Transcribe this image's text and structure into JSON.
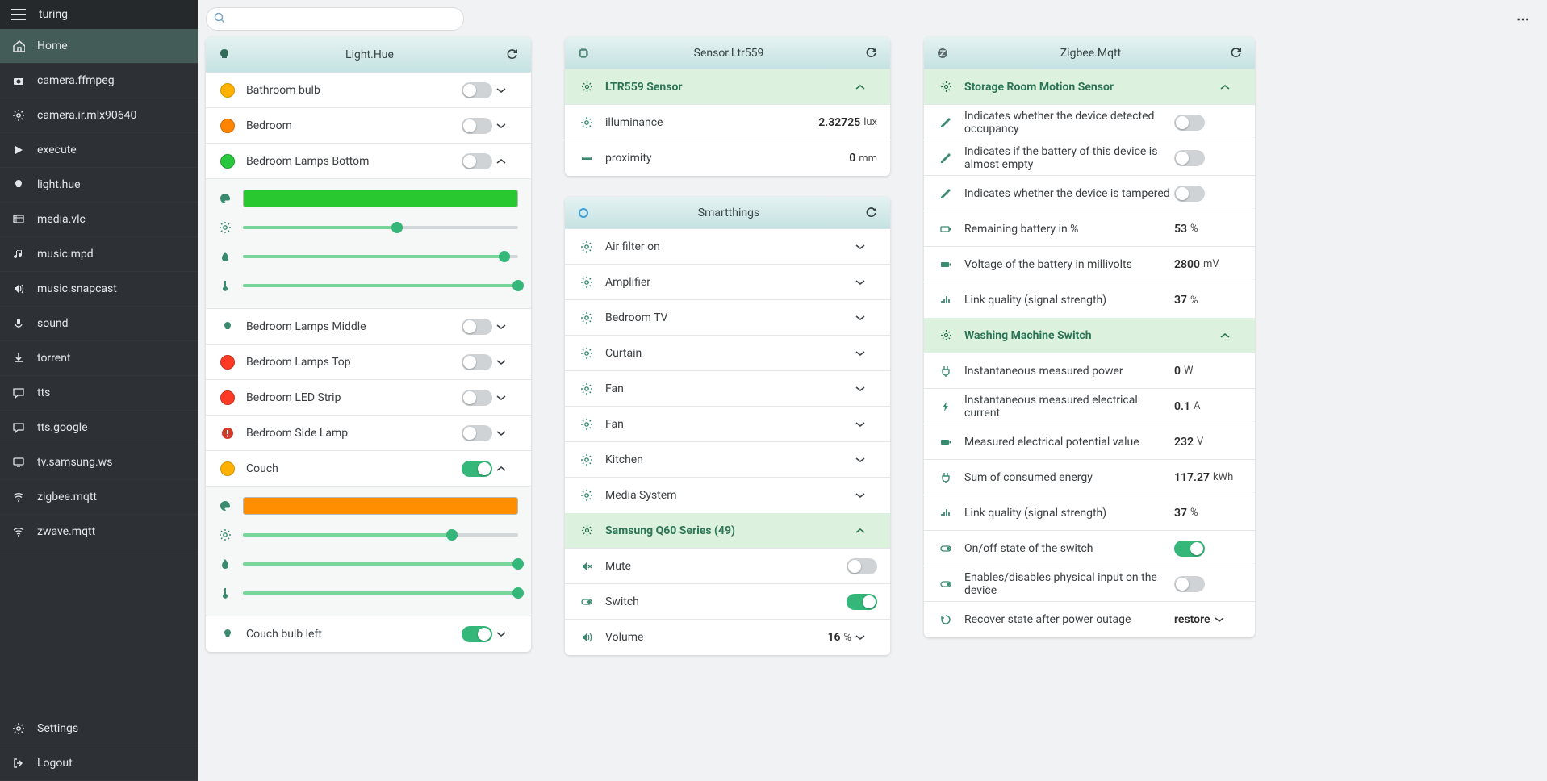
{
  "app_title": "turing",
  "sidebar": {
    "items": [
      {
        "icon": "home",
        "label": "Home",
        "active": true
      },
      {
        "icon": "camera",
        "label": "camera.ffmpeg"
      },
      {
        "icon": "gear",
        "label": "camera.ir.mlx90640"
      },
      {
        "icon": "play",
        "label": "execute"
      },
      {
        "icon": "bulb",
        "label": "light.hue"
      },
      {
        "icon": "media",
        "label": "media.vlc"
      },
      {
        "icon": "music",
        "label": "music.mpd"
      },
      {
        "icon": "volume",
        "label": "music.snapcast"
      },
      {
        "icon": "mic",
        "label": "sound"
      },
      {
        "icon": "torrent",
        "label": "torrent"
      },
      {
        "icon": "chat",
        "label": "tts"
      },
      {
        "icon": "chat",
        "label": "tts.google"
      },
      {
        "icon": "tv",
        "label": "tv.samsung.ws"
      },
      {
        "icon": "wifi",
        "label": "zigbee.mqtt"
      },
      {
        "icon": "wifi",
        "label": "zwave.mqtt"
      }
    ],
    "bottom": [
      {
        "icon": "gear",
        "label": "Settings"
      },
      {
        "icon": "logout",
        "label": "Logout"
      }
    ]
  },
  "search": {
    "placeholder": ""
  },
  "cards": {
    "light": {
      "title": "Light.Hue",
      "items": [
        {
          "label": "Bathroom bulb",
          "bulb": "yellow",
          "on": false,
          "expanded": false
        },
        {
          "label": "Bedroom",
          "bulb": "orange",
          "on": false,
          "expanded": false
        },
        {
          "label": "Bedroom Lamps Bottom",
          "bulb": "green",
          "on": false,
          "expanded": true,
          "ctrl": {
            "color": "#2ac830",
            "b": 56,
            "s": 95,
            "t": 100
          }
        },
        {
          "label": "Bedroom Lamps Middle",
          "bulb": "outline",
          "on": false,
          "expanded": false
        },
        {
          "label": "Bedroom Lamps Top",
          "bulb": "red",
          "on": false,
          "expanded": false
        },
        {
          "label": "Bedroom LED Strip",
          "bulb": "red",
          "on": false,
          "expanded": false
        },
        {
          "label": "Bedroom Side Lamp",
          "bulb": "warn",
          "on": false,
          "expanded": false
        },
        {
          "label": "Couch",
          "bulb": "yellow",
          "on": true,
          "expanded": true,
          "ctrl": {
            "color": "#ff8f00",
            "b": 76,
            "s": 100,
            "t": 100
          }
        },
        {
          "label": "Couch bulb left",
          "bulb": "outline",
          "on": true,
          "expanded": false
        }
      ]
    },
    "sensor": {
      "title": "Sensor.Ltr559",
      "group": "LTR559 Sensor",
      "rows": [
        {
          "icon": "gear",
          "label": "illuminance",
          "val": "2.32725",
          "unit": "lux"
        },
        {
          "icon": "ruler",
          "label": "proximity",
          "val": "0",
          "unit": "mm"
        }
      ]
    },
    "smart": {
      "title": "Smartthings",
      "groups": [
        {
          "label": "Air filter on",
          "icon": "gear"
        },
        {
          "label": "Amplifier",
          "icon": "gear"
        },
        {
          "label": "Bedroom TV",
          "icon": "gear"
        },
        {
          "label": "Curtain",
          "icon": "gear"
        },
        {
          "label": "Fan",
          "icon": "gear"
        },
        {
          "label": "Fan",
          "icon": "gear"
        },
        {
          "label": "Kitchen",
          "icon": "gear"
        },
        {
          "label": "Media System",
          "icon": "gear"
        }
      ],
      "samsung": {
        "title": "Samsung Q60 Series (49)",
        "rows": [
          {
            "icon": "mute",
            "label": "Mute",
            "type": "toggle",
            "on": false
          },
          {
            "icon": "toggle",
            "label": "Switch",
            "type": "toggle",
            "on": true
          },
          {
            "icon": "volume",
            "label": "Volume",
            "type": "value",
            "val": "16",
            "unit": "%"
          }
        ]
      }
    },
    "zigbee": {
      "title": "Zigbee.Mqtt",
      "motion": {
        "title": "Storage Room Motion Sensor",
        "rows": [
          {
            "icon": "pencil",
            "label": "Indicates whether the device detected occupancy",
            "type": "toggle",
            "on": false
          },
          {
            "icon": "pencil",
            "label": "Indicates if the battery of this device is almost empty",
            "type": "toggle",
            "on": false
          },
          {
            "icon": "pencil",
            "label": "Indicates whether the device is tampered",
            "type": "toggle",
            "on": false
          },
          {
            "icon": "battery",
            "label": "Remaining battery in %",
            "type": "value",
            "val": "53",
            "unit": "%"
          },
          {
            "icon": "battery2",
            "label": "Voltage of the battery in millivolts",
            "type": "value",
            "val": "2800",
            "unit": "mV"
          },
          {
            "icon": "signal",
            "label": "Link quality (signal strength)",
            "type": "value",
            "val": "37",
            "unit": "%"
          }
        ]
      },
      "washing": {
        "title": "Washing Machine Switch",
        "rows": [
          {
            "icon": "plug",
            "label": "Instantaneous measured power",
            "type": "value",
            "val": "0",
            "unit": "W"
          },
          {
            "icon": "bolt",
            "label": "Instantaneous measured electrical current",
            "type": "value",
            "val": "0.1",
            "unit": "A"
          },
          {
            "icon": "battery2",
            "label": "Measured electrical potential value",
            "type": "value",
            "val": "232",
            "unit": "V"
          },
          {
            "icon": "plug",
            "label": "Sum of consumed energy",
            "type": "value",
            "val": "117.27",
            "unit": "kWh"
          },
          {
            "icon": "signal",
            "label": "Link quality (signal strength)",
            "type": "value",
            "val": "37",
            "unit": "%"
          },
          {
            "icon": "toggle",
            "label": "On/off state of the switch",
            "type": "toggle",
            "on": true
          },
          {
            "icon": "toggle",
            "label": "Enables/disables physical input on the device",
            "type": "toggle",
            "on": false
          },
          {
            "icon": "restore",
            "label": "Recover state after power outage",
            "type": "select",
            "val": "restore"
          }
        ]
      }
    }
  }
}
